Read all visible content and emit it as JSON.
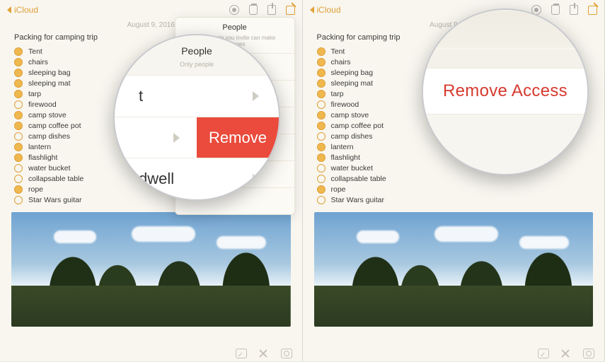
{
  "nav": {
    "back_label": "iCloud"
  },
  "date": "August 9, 2016",
  "note": {
    "title": "Packing for camping trip",
    "items": [
      {
        "label": "Tent",
        "checked": true
      },
      {
        "label": "chairs",
        "checked": true
      },
      {
        "label": "sleeping bag",
        "checked": true
      },
      {
        "label": "sleeping mat",
        "checked": true
      },
      {
        "label": "tarp",
        "checked": true
      },
      {
        "label": "firewood",
        "checked": false
      },
      {
        "label": "camp stove",
        "checked": true
      },
      {
        "label": "camp coffee pot",
        "checked": true
      },
      {
        "label": "camp dishes",
        "checked": false
      },
      {
        "label": "lantern",
        "checked": true
      },
      {
        "label": "flashlight",
        "checked": true
      },
      {
        "label": "water bucket",
        "checked": false
      },
      {
        "label": "collapsable table",
        "checked": false
      },
      {
        "label": "rope",
        "checked": true
      },
      {
        "label": "Star Wars guitar",
        "checked": false
      }
    ]
  },
  "popover": {
    "title": "People",
    "subtitle": "Only people you invite can make changes"
  },
  "magnifier1": {
    "header": "People",
    "sub": "Only people",
    "row1_partial": "t",
    "remove_label": "Remove",
    "row3_partial": "dwell"
  },
  "magnifier2": {
    "action_label": "Remove Access"
  }
}
